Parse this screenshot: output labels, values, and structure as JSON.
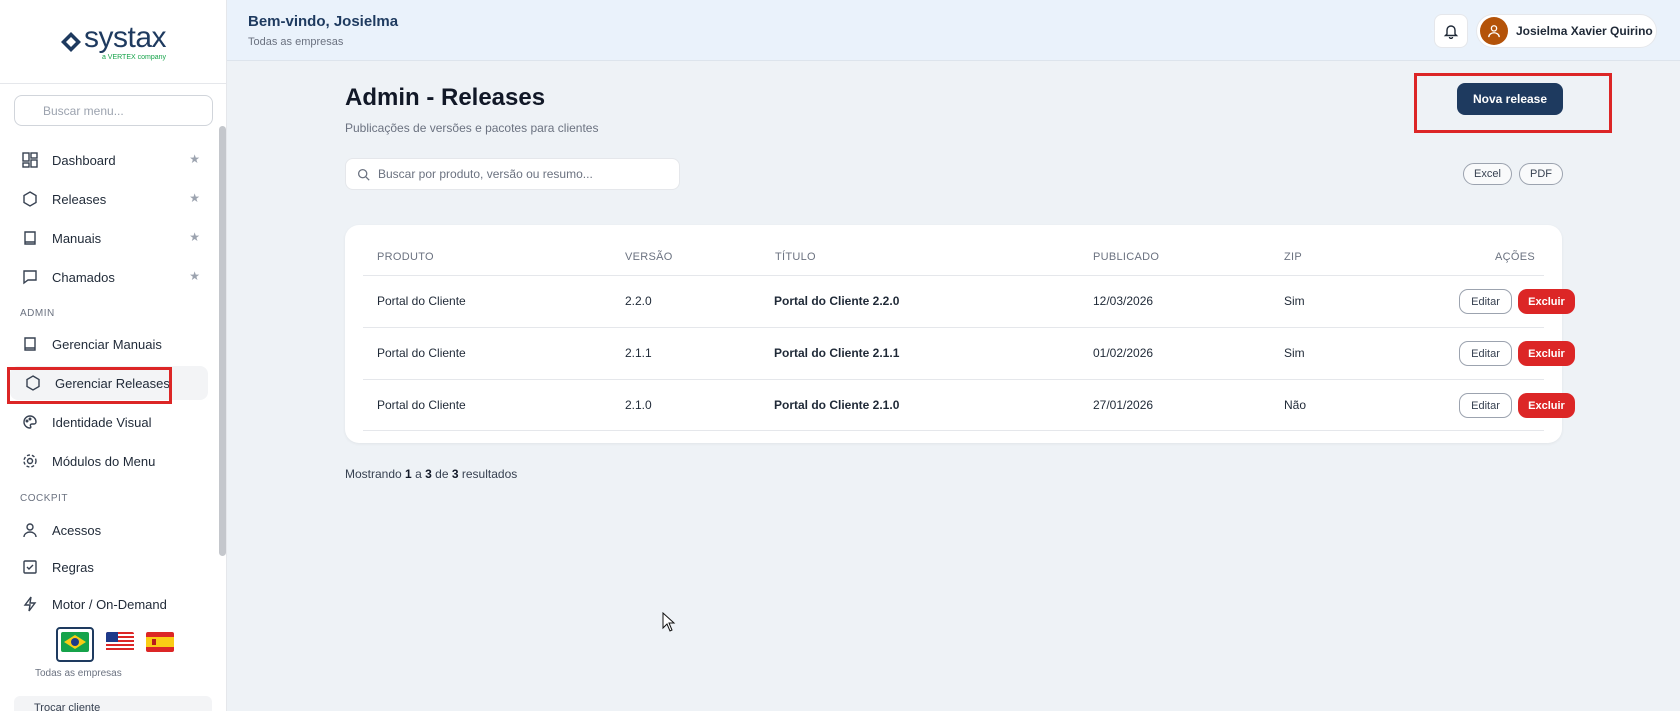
{
  "brand": {
    "name": "systax",
    "tagline": "a VERTEX company"
  },
  "sidebar": {
    "search_placeholder": "Buscar menu...",
    "items": [
      {
        "label": "Dashboard",
        "icon": "dashboard-icon",
        "starred": true
      },
      {
        "label": "Releases",
        "icon": "hexagon-icon",
        "starred": true
      },
      {
        "label": "Manuais",
        "icon": "book-icon",
        "starred": true
      },
      {
        "label": "Chamados",
        "icon": "chat-icon",
        "starred": true
      }
    ],
    "admin_label": "ADMIN",
    "admin_items": [
      {
        "label": "Gerenciar Manuais",
        "icon": "book-icon"
      },
      {
        "label": "Gerenciar Releases",
        "icon": "hexagon-icon",
        "active": true
      },
      {
        "label": "Identidade Visual",
        "icon": "palette-icon"
      },
      {
        "label": "Módulos do Menu",
        "icon": "gear-icon"
      }
    ],
    "cockpit_label": "COCKPIT",
    "cockpit_items": [
      {
        "label": "Acessos",
        "icon": "user-icon"
      },
      {
        "label": "Regras",
        "icon": "checkbox-icon"
      },
      {
        "label": "Motor / On-Demand",
        "icon": "lightning-icon"
      }
    ],
    "languages": [
      "pt-BR",
      "en-US",
      "es-ES"
    ],
    "company_scope": "Todas as empresas",
    "switch_client": "Trocar cliente"
  },
  "header": {
    "welcome": "Bem-vindo, Josielma",
    "company": "Todas as empresas",
    "user_name": "Josielma Xavier Quirino"
  },
  "page": {
    "title": "Admin - Releases",
    "subtitle": "Publicações de versões e pacotes para clientes",
    "new_button": "Nova release",
    "search_placeholder": "Buscar por produto, versão ou resumo...",
    "export_excel": "Excel",
    "export_pdf": "PDF"
  },
  "table": {
    "headers": [
      "PRODUTO",
      "VERSÃO",
      "TÍTULO",
      "PUBLICADO",
      "ZIP",
      "AÇÕES"
    ],
    "rows": [
      {
        "produto": "Portal do Cliente",
        "versao": "2.2.0",
        "titulo": "Portal do Cliente 2.2.0",
        "publicado": "12/03/2026",
        "zip": "Sim"
      },
      {
        "produto": "Portal do Cliente",
        "versao": "2.1.1",
        "titulo": "Portal do Cliente 2.1.1",
        "publicado": "01/02/2026",
        "zip": "Sim"
      },
      {
        "produto": "Portal do Cliente",
        "versao": "2.1.0",
        "titulo": "Portal do Cliente 2.1.0",
        "publicado": "27/01/2026",
        "zip": "Não"
      }
    ],
    "edit_label": "Editar",
    "delete_label": "Excluir"
  },
  "footer": {
    "prefix": "Mostrando",
    "from": "1",
    "sep1": "a",
    "to": "3",
    "sep2": "de",
    "total": "3",
    "suffix": "resultados"
  },
  "colors": {
    "primary": "#1e3a5f",
    "danger": "#dc2626",
    "highlight": "#dc2626"
  }
}
